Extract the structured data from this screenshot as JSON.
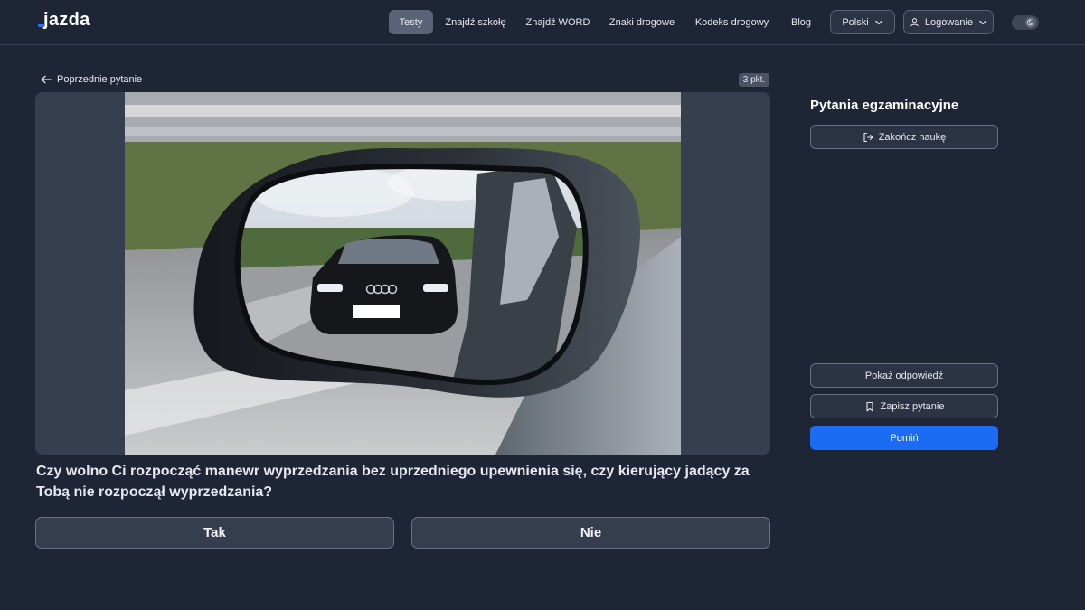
{
  "nav": {
    "logo": "jazda",
    "links": [
      "Testy",
      "Znajdź szkołę",
      "Znajdź WORD",
      "Znaki drogowe",
      "Kodeks drogowy",
      "Blog"
    ],
    "language": "Polski",
    "login": "Logowanie",
    "accent_color": "#2f6df6"
  },
  "question": {
    "prev_label": "Poprzednie pytanie",
    "points": "3 pkt.",
    "text": "Czy wolno Ci rozpocząć manewr wyprzedzania bez uprzedniego upewnienia się, czy kierujący jadący za Tobą nie rozpoczął wyprzedzania?",
    "answers": [
      "Tak",
      "Nie"
    ]
  },
  "sidebar": {
    "title": "Pytania egzaminacyjne",
    "end_label": "Zakończ naukę",
    "show_answer_label": "Pokaż odpowiedź",
    "save_label": "Zapisz pytanie",
    "skip_label": "Pomiń",
    "primary_color": "#1b6cf2"
  }
}
